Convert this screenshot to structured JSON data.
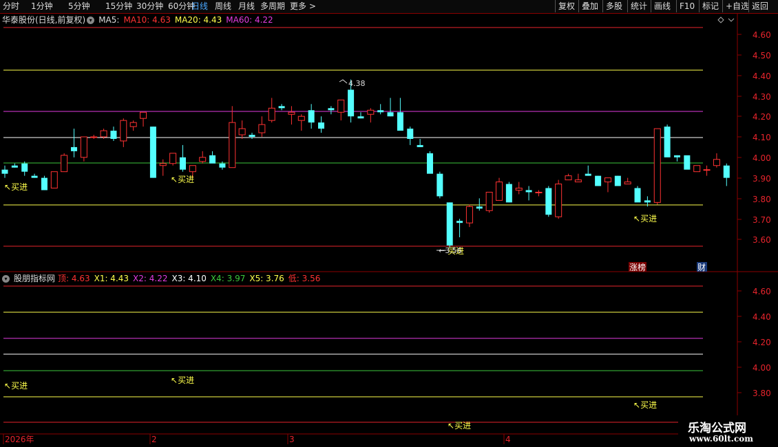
{
  "toolbar": {
    "periods": [
      "分时",
      "1分钟",
      "5分钟",
      "15分钟",
      "30分钟",
      "60分钟",
      "日线",
      "周线",
      "月线",
      "多周期",
      "更多"
    ],
    "active_index": 6,
    "right_buttons": [
      "复权",
      "叠加",
      "多股",
      "统计",
      "画线",
      "F10",
      "标记",
      "+自选",
      "返回"
    ]
  },
  "main_info": {
    "title": "华泰股份(日线,前复权)",
    "ma5": "MA5:",
    "ma10": "MA10: 4.63",
    "ma20": "MA20: 4.43",
    "ma60": "MA60: 4.22"
  },
  "sub_info": {
    "title": "股朋指标网",
    "ding": "顶: 4.63",
    "x1": "X1: 4.43",
    "x2": "X2: 4.22",
    "x3": "X3: 4.10",
    "x4": "X4: 3.97",
    "x5": "X5: 3.76",
    "di": "低: 3.56"
  },
  "main_axis": [
    "4.60",
    "4.50",
    "4.40",
    "4.30",
    "4.20",
    "4.10",
    "4.00",
    "3.90",
    "3.80",
    "3.70",
    "3.60"
  ],
  "sub_axis": [
    "4.60",
    "4.40",
    "4.20",
    "4.00",
    "3.80"
  ],
  "annotations": {
    "buy": "买进",
    "high_value": "4.38",
    "low_value": "3.56",
    "zhangbang": "涨榜",
    "cai": "财"
  },
  "dates": [
    "2026年",
    "2",
    "3",
    "4"
  ],
  "logo": {
    "title": "乐淘公式网",
    "url": "www.60lt.com"
  },
  "colors": {
    "up": "#ff3232",
    "down": "#54ffff",
    "level_top": "#e8242c",
    "level_x1": "#ffff4c",
    "level_x2": "#e23ce0",
    "level_x3": "#ffffff",
    "level_x4": "#3cc83c",
    "level_x5": "#ffff4c",
    "level_low": "#e8242c"
  },
  "candles": [
    [
      3.94,
      3.96,
      3.9,
      3.92
    ],
    [
      3.96,
      3.97,
      3.95,
      3.95
    ],
    [
      3.97,
      3.98,
      3.91,
      3.93
    ],
    [
      3.91,
      3.92,
      3.9,
      3.9
    ],
    [
      3.9,
      3.91,
      3.84,
      3.84
    ],
    [
      3.85,
      3.92,
      3.85,
      3.93
    ],
    [
      3.93,
      4.02,
      3.93,
      4.01
    ],
    [
      4.05,
      4.14,
      4.0,
      4.03
    ],
    [
      4.0,
      4.1,
      3.98,
      4.1
    ],
    [
      4.1,
      4.11,
      4.09,
      4.1
    ],
    [
      4.1,
      4.14,
      4.09,
      4.13
    ],
    [
      4.13,
      4.15,
      4.08,
      4.09
    ],
    [
      4.08,
      4.19,
      4.05,
      4.18
    ],
    [
      4.15,
      4.18,
      4.13,
      4.17
    ],
    [
      4.19,
      4.22,
      4.15,
      4.22
    ],
    [
      4.15,
      4.15,
      3.9,
      3.9
    ],
    [
      3.96,
      3.99,
      3.91,
      3.97
    ],
    [
      3.97,
      4.02,
      3.96,
      4.02
    ],
    [
      4.0,
      4.06,
      3.93,
      3.94
    ],
    [
      3.93,
      3.95,
      3.9,
      3.96
    ],
    [
      3.98,
      4.03,
      3.97,
      4.0
    ],
    [
      4.01,
      4.03,
      3.98,
      3.97
    ],
    [
      3.97,
      3.98,
      3.94,
      3.95
    ],
    [
      3.95,
      4.25,
      3.95,
      4.17
    ],
    [
      4.11,
      4.18,
      4.09,
      4.14
    ],
    [
      4.11,
      4.12,
      4.09,
      4.1
    ],
    [
      4.12,
      4.2,
      4.1,
      4.16
    ],
    [
      4.18,
      4.29,
      4.17,
      4.24
    ],
    [
      4.25,
      4.26,
      4.23,
      4.24
    ],
    [
      4.21,
      4.25,
      4.16,
      4.22
    ],
    [
      4.18,
      4.21,
      4.13,
      4.2
    ],
    [
      4.23,
      4.26,
      4.14,
      4.17
    ],
    [
      4.17,
      4.2,
      4.12,
      4.14
    ],
    [
      4.24,
      4.25,
      4.21,
      4.23
    ],
    [
      4.22,
      4.28,
      4.18,
      4.28
    ],
    [
      4.33,
      4.38,
      4.17,
      4.2
    ],
    [
      4.2,
      4.22,
      4.19,
      4.19
    ],
    [
      4.21,
      4.24,
      4.17,
      4.23
    ],
    [
      4.23,
      4.26,
      4.21,
      4.22
    ],
    [
      4.22,
      4.29,
      4.2,
      4.2
    ],
    [
      4.22,
      4.29,
      4.15,
      4.13
    ],
    [
      4.14,
      4.15,
      4.06,
      4.09
    ],
    [
      4.06,
      4.09,
      4.05,
      4.05
    ],
    [
      4.02,
      4.03,
      3.93,
      3.92
    ],
    [
      3.92,
      3.93,
      3.8,
      3.81
    ],
    [
      3.78,
      3.78,
      3.56,
      3.57
    ],
    [
      3.69,
      3.7,
      3.61,
      3.68
    ],
    [
      3.68,
      3.77,
      3.66,
      3.76
    ],
    [
      3.76,
      3.8,
      3.74,
      3.75
    ],
    [
      3.74,
      3.83,
      3.73,
      3.83
    ],
    [
      3.79,
      3.9,
      3.79,
      3.88
    ],
    [
      3.87,
      3.88,
      3.78,
      3.78
    ],
    [
      3.84,
      3.88,
      3.82,
      3.85
    ],
    [
      3.84,
      3.86,
      3.79,
      3.83
    ],
    [
      3.83,
      3.84,
      3.81,
      3.83
    ],
    [
      3.85,
      3.86,
      3.71,
      3.72
    ],
    [
      3.71,
      3.89,
      3.7,
      3.87
    ],
    [
      3.89,
      3.92,
      3.89,
      3.91
    ],
    [
      3.88,
      3.92,
      3.88,
      3.89
    ],
    [
      3.92,
      3.96,
      3.91,
      3.91
    ],
    [
      3.91,
      3.91,
      3.86,
      3.86
    ],
    [
      3.88,
      3.9,
      3.83,
      3.9
    ],
    [
      3.91,
      3.91,
      3.86,
      3.86
    ],
    [
      3.87,
      3.9,
      3.87,
      3.88
    ],
    [
      3.85,
      3.86,
      3.79,
      3.78
    ],
    [
      3.79,
      3.81,
      3.76,
      3.78
    ],
    [
      3.78,
      4.14,
      3.77,
      4.14
    ],
    [
      4.15,
      4.16,
      4.01,
      4.0
    ],
    [
      4.01,
      4.01,
      3.98,
      4.0
    ],
    [
      4.01,
      4.0,
      3.95,
      3.94
    ],
    [
      3.93,
      3.95,
      3.93,
      3.96
    ],
    [
      3.94,
      3.96,
      3.91,
      3.94
    ],
    [
      3.96,
      4.02,
      3.95,
      3.99
    ],
    [
      3.96,
      3.97,
      3.86,
      3.9
    ]
  ]
}
